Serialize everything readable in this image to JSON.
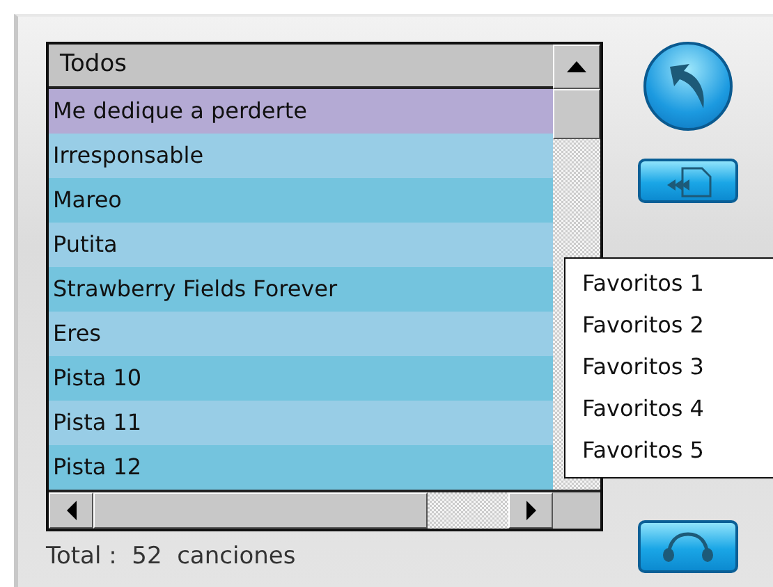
{
  "list": {
    "header": "Todos",
    "rows": [
      {
        "title": "Me dedique a perderte",
        "selected": true
      },
      {
        "title": "Irresponsable",
        "selected": false
      },
      {
        "title": "Mareo",
        "selected": false
      },
      {
        "title": "Putita",
        "selected": false
      },
      {
        "title": "Strawberry Fields Forever",
        "selected": false
      },
      {
        "title": "Eres",
        "selected": false
      },
      {
        "title": "Pista 10",
        "selected": false
      },
      {
        "title": "Pista 11",
        "selected": false
      },
      {
        "title": "Pista 12",
        "selected": false
      }
    ]
  },
  "status": "Total :  52  canciones",
  "menu": {
    "items": [
      "Favoritos 1",
      "Favoritos 2",
      "Favoritos 3",
      "Favoritos 4",
      "Favoritos 5"
    ]
  }
}
